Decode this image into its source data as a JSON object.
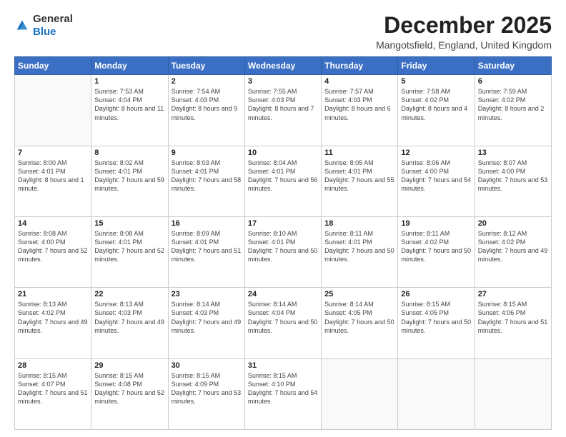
{
  "logo": {
    "general": "General",
    "blue": "Blue"
  },
  "header": {
    "month": "December 2025",
    "location": "Mangotsfield, England, United Kingdom"
  },
  "weekdays": [
    "Sunday",
    "Monday",
    "Tuesday",
    "Wednesday",
    "Thursday",
    "Friday",
    "Saturday"
  ],
  "weeks": [
    [
      {
        "day": "",
        "sunrise": "",
        "sunset": "",
        "daylight": ""
      },
      {
        "day": "1",
        "sunrise": "Sunrise: 7:53 AM",
        "sunset": "Sunset: 4:04 PM",
        "daylight": "Daylight: 8 hours and 11 minutes."
      },
      {
        "day": "2",
        "sunrise": "Sunrise: 7:54 AM",
        "sunset": "Sunset: 4:03 PM",
        "daylight": "Daylight: 8 hours and 9 minutes."
      },
      {
        "day": "3",
        "sunrise": "Sunrise: 7:55 AM",
        "sunset": "Sunset: 4:03 PM",
        "daylight": "Daylight: 8 hours and 7 minutes."
      },
      {
        "day": "4",
        "sunrise": "Sunrise: 7:57 AM",
        "sunset": "Sunset: 4:03 PM",
        "daylight": "Daylight: 8 hours and 6 minutes."
      },
      {
        "day": "5",
        "sunrise": "Sunrise: 7:58 AM",
        "sunset": "Sunset: 4:02 PM",
        "daylight": "Daylight: 8 hours and 4 minutes."
      },
      {
        "day": "6",
        "sunrise": "Sunrise: 7:59 AM",
        "sunset": "Sunset: 4:02 PM",
        "daylight": "Daylight: 8 hours and 2 minutes."
      }
    ],
    [
      {
        "day": "7",
        "sunrise": "Sunrise: 8:00 AM",
        "sunset": "Sunset: 4:01 PM",
        "daylight": "Daylight: 8 hours and 1 minute."
      },
      {
        "day": "8",
        "sunrise": "Sunrise: 8:02 AM",
        "sunset": "Sunset: 4:01 PM",
        "daylight": "Daylight: 7 hours and 59 minutes."
      },
      {
        "day": "9",
        "sunrise": "Sunrise: 8:03 AM",
        "sunset": "Sunset: 4:01 PM",
        "daylight": "Daylight: 7 hours and 58 minutes."
      },
      {
        "day": "10",
        "sunrise": "Sunrise: 8:04 AM",
        "sunset": "Sunset: 4:01 PM",
        "daylight": "Daylight: 7 hours and 56 minutes."
      },
      {
        "day": "11",
        "sunrise": "Sunrise: 8:05 AM",
        "sunset": "Sunset: 4:01 PM",
        "daylight": "Daylight: 7 hours and 55 minutes."
      },
      {
        "day": "12",
        "sunrise": "Sunrise: 8:06 AM",
        "sunset": "Sunset: 4:00 PM",
        "daylight": "Daylight: 7 hours and 54 minutes."
      },
      {
        "day": "13",
        "sunrise": "Sunrise: 8:07 AM",
        "sunset": "Sunset: 4:00 PM",
        "daylight": "Daylight: 7 hours and 53 minutes."
      }
    ],
    [
      {
        "day": "14",
        "sunrise": "Sunrise: 8:08 AM",
        "sunset": "Sunset: 4:00 PM",
        "daylight": "Daylight: 7 hours and 52 minutes."
      },
      {
        "day": "15",
        "sunrise": "Sunrise: 8:08 AM",
        "sunset": "Sunset: 4:01 PM",
        "daylight": "Daylight: 7 hours and 52 minutes."
      },
      {
        "day": "16",
        "sunrise": "Sunrise: 8:09 AM",
        "sunset": "Sunset: 4:01 PM",
        "daylight": "Daylight: 7 hours and 51 minutes."
      },
      {
        "day": "17",
        "sunrise": "Sunrise: 8:10 AM",
        "sunset": "Sunset: 4:01 PM",
        "daylight": "Daylight: 7 hours and 50 minutes."
      },
      {
        "day": "18",
        "sunrise": "Sunrise: 8:11 AM",
        "sunset": "Sunset: 4:01 PM",
        "daylight": "Daylight: 7 hours and 50 minutes."
      },
      {
        "day": "19",
        "sunrise": "Sunrise: 8:11 AM",
        "sunset": "Sunset: 4:02 PM",
        "daylight": "Daylight: 7 hours and 50 minutes."
      },
      {
        "day": "20",
        "sunrise": "Sunrise: 8:12 AM",
        "sunset": "Sunset: 4:02 PM",
        "daylight": "Daylight: 7 hours and 49 minutes."
      }
    ],
    [
      {
        "day": "21",
        "sunrise": "Sunrise: 8:13 AM",
        "sunset": "Sunset: 4:02 PM",
        "daylight": "Daylight: 7 hours and 49 minutes."
      },
      {
        "day": "22",
        "sunrise": "Sunrise: 8:13 AM",
        "sunset": "Sunset: 4:03 PM",
        "daylight": "Daylight: 7 hours and 49 minutes."
      },
      {
        "day": "23",
        "sunrise": "Sunrise: 8:14 AM",
        "sunset": "Sunset: 4:03 PM",
        "daylight": "Daylight: 7 hours and 49 minutes."
      },
      {
        "day": "24",
        "sunrise": "Sunrise: 8:14 AM",
        "sunset": "Sunset: 4:04 PM",
        "daylight": "Daylight: 7 hours and 50 minutes."
      },
      {
        "day": "25",
        "sunrise": "Sunrise: 8:14 AM",
        "sunset": "Sunset: 4:05 PM",
        "daylight": "Daylight: 7 hours and 50 minutes."
      },
      {
        "day": "26",
        "sunrise": "Sunrise: 8:15 AM",
        "sunset": "Sunset: 4:05 PM",
        "daylight": "Daylight: 7 hours and 50 minutes."
      },
      {
        "day": "27",
        "sunrise": "Sunrise: 8:15 AM",
        "sunset": "Sunset: 4:06 PM",
        "daylight": "Daylight: 7 hours and 51 minutes."
      }
    ],
    [
      {
        "day": "28",
        "sunrise": "Sunrise: 8:15 AM",
        "sunset": "Sunset: 4:07 PM",
        "daylight": "Daylight: 7 hours and 51 minutes."
      },
      {
        "day": "29",
        "sunrise": "Sunrise: 8:15 AM",
        "sunset": "Sunset: 4:08 PM",
        "daylight": "Daylight: 7 hours and 52 minutes."
      },
      {
        "day": "30",
        "sunrise": "Sunrise: 8:15 AM",
        "sunset": "Sunset: 4:09 PM",
        "daylight": "Daylight: 7 hours and 53 minutes."
      },
      {
        "day": "31",
        "sunrise": "Sunrise: 8:15 AM",
        "sunset": "Sunset: 4:10 PM",
        "daylight": "Daylight: 7 hours and 54 minutes."
      },
      {
        "day": "",
        "sunrise": "",
        "sunset": "",
        "daylight": ""
      },
      {
        "day": "",
        "sunrise": "",
        "sunset": "",
        "daylight": ""
      },
      {
        "day": "",
        "sunrise": "",
        "sunset": "",
        "daylight": ""
      }
    ]
  ]
}
